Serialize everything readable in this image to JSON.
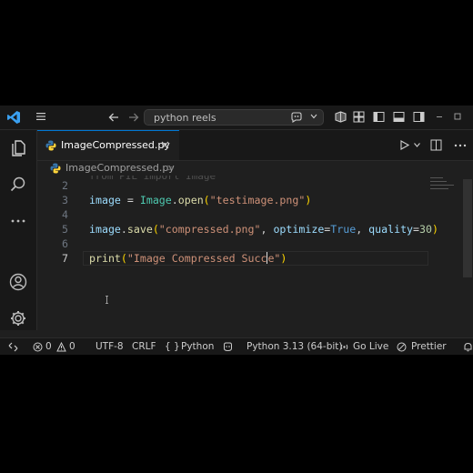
{
  "titlebar": {
    "search_label": "python reels"
  },
  "tabs": [
    {
      "label": "ImageCompressed.py"
    }
  ],
  "breadcrumb": {
    "file": "ImageCompressed.py",
    "separator": ">"
  },
  "editor": {
    "ghost_line": "from PIL import Image",
    "lines": [
      {
        "number": "2"
      },
      {
        "number": "3"
      },
      {
        "number": "4"
      },
      {
        "number": "5"
      },
      {
        "number": "6"
      },
      {
        "number": "7"
      }
    ],
    "line3": {
      "var": "image",
      "op": " = ",
      "cls": "Image",
      "dot": ".",
      "fn": "open",
      "lp": "(",
      "str": "\"testimage.png\"",
      "rp": ")"
    },
    "line5": {
      "var": "image",
      "dot": ".",
      "fn": "save",
      "lp": "(",
      "str": "\"compressed.png\"",
      "comma1": ", ",
      "kw1": "optimize",
      "eq1": "=",
      "kwv": "True",
      "comma2": ", ",
      "kw2": "quality",
      "eq2": "=",
      "num": "30",
      "rp": ")"
    },
    "line7": {
      "fn": "print",
      "lp": "(",
      "str_a": "\"Image Compressed Succ",
      "str_b": "e\"",
      "rp": ")"
    }
  },
  "statusbar": {
    "errors": "0",
    "warnings": "0",
    "encoding": "UTF-8",
    "eol": "CRLF",
    "braces": "{ }",
    "language": "Python",
    "interpreter": "Python 3.13 (64-bit)",
    "golive": "Go Live",
    "prettier": "Prettier"
  },
  "colors": {
    "accent": "#0078d4",
    "python_blue": "#3776ab",
    "python_yellow": "#ffd43b"
  }
}
